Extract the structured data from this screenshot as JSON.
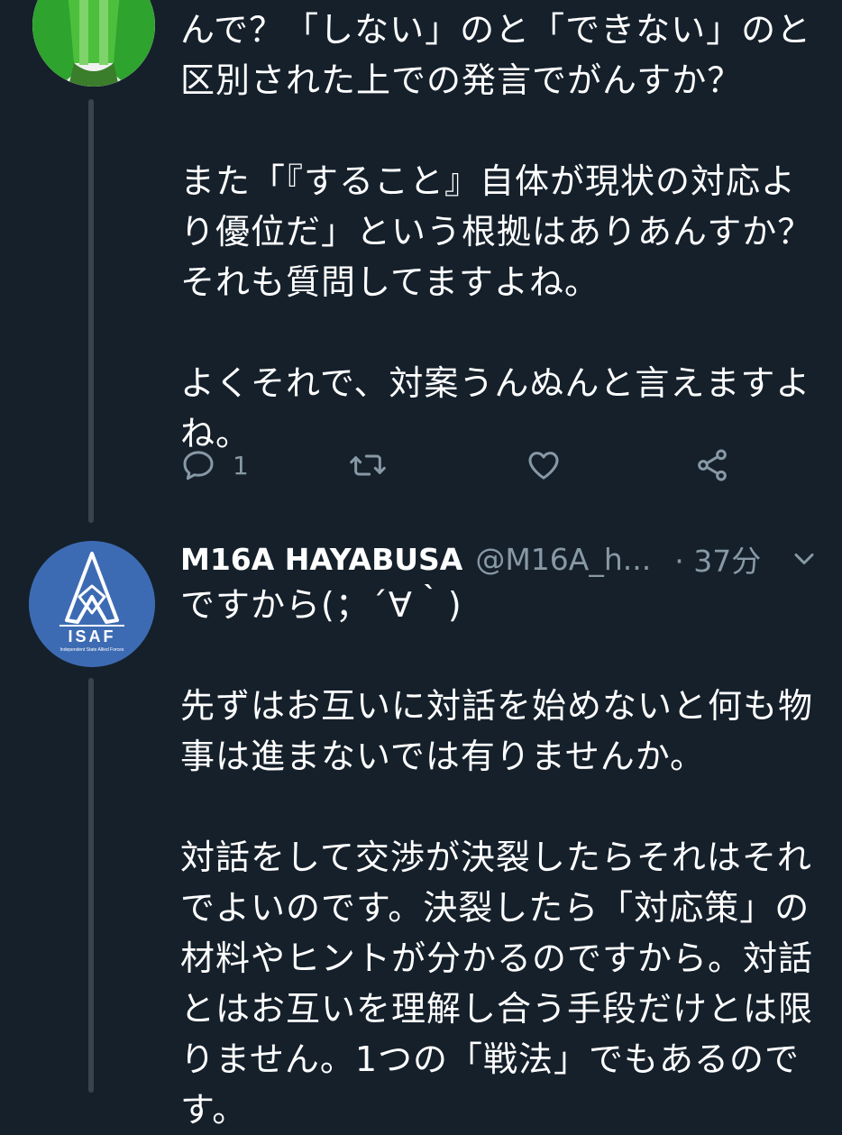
{
  "tweet1": {
    "text": "んで？「しない」のと「できない」のと\n区別された上での発言でがんすか？\n\nまた「『すること』自体が現状の対応よ\nり優位だ」という根拠はありあんすか？\nそれも質問してますよね。\n\nよくそれで、対案うんぬんと言えますよ\nね。",
    "actions": {
      "reply_count": "1"
    }
  },
  "tweet2": {
    "display_name": "M16A HAYABUSA",
    "handle": "@M16A_h...",
    "time": "· 37分",
    "avatar_text": "ISAF",
    "avatar_subtext": "Independent State Allied Forces",
    "text": "ですから(；´∀｀)\n\n先ずはお互いに対話を始めないと何も物\n事は進まないでは有りませんか。\n\n対話をして交渉が決裂したらそれはそれ\nでよいのです。決裂したら「対応策」の\n材料やヒントが分かるのですから。対話\nとはお互いを理解し合う手段だけとは限\nりません。1つの「戦法」でもあるので\nす。"
  },
  "colors": {
    "background": "#15202b",
    "text": "#ffffff",
    "secondary": "#8899a6",
    "thread_line": "#38444d",
    "isaf_blue": "#3d6bb3"
  }
}
